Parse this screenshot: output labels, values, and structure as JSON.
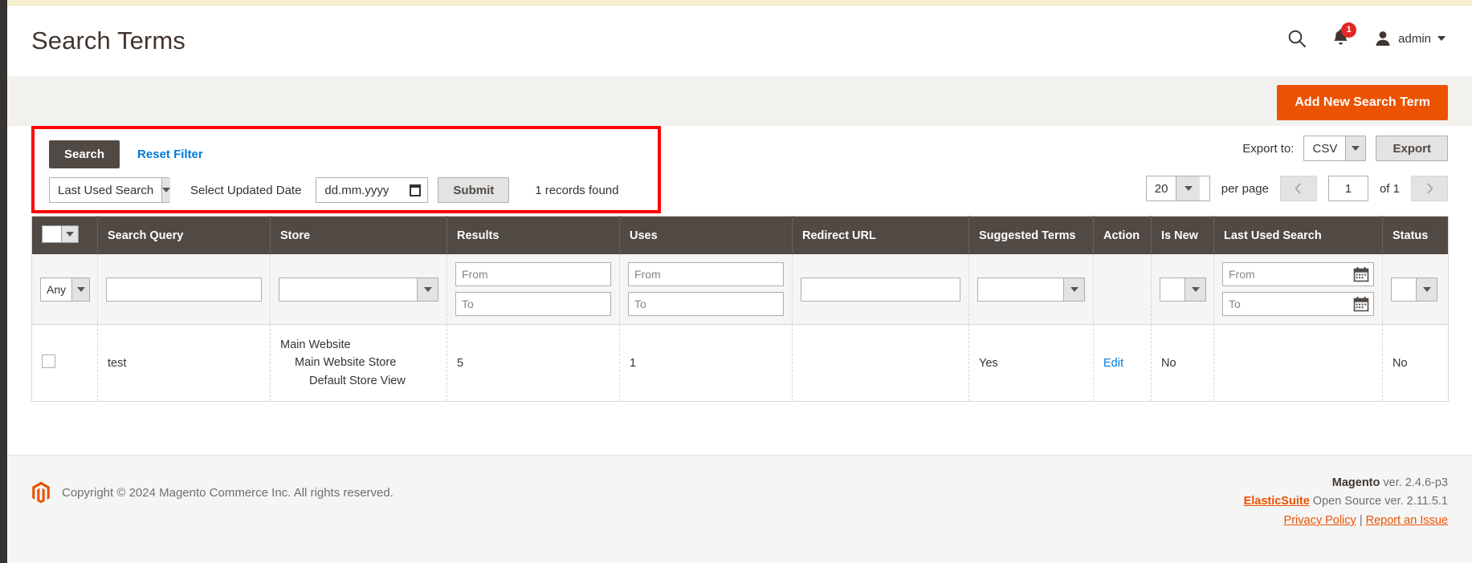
{
  "header": {
    "title": "Search Terms",
    "search_icon": "search-icon",
    "notifications_icon": "bell-icon",
    "notifications_count": "1",
    "user_icon": "user-avatar-icon",
    "user_name": "admin",
    "user_caret": "chevron-down-icon"
  },
  "page_actions": {
    "add_new_label": "Add New Search Term"
  },
  "filters": {
    "search_button": "Search",
    "reset_filter": "Reset Filter",
    "scope_select_value": "Last Used Search",
    "updated_date_label": "Select Updated Date",
    "date_placeholder": "dd.mm.yyyy",
    "date_value": "",
    "submit_button": "Submit",
    "records_found": "1 records found"
  },
  "export": {
    "label": "Export to:",
    "format_value": "CSV",
    "button": "Export"
  },
  "pager": {
    "per_page_value": "20",
    "per_page_label": "per page",
    "prev_icon": "chevron-left-icon",
    "current_page": "1",
    "of_label": "of 1",
    "next_icon": "chevron-right-icon"
  },
  "grid": {
    "columns": [
      {
        "label": ""
      },
      {
        "label": "Search Query"
      },
      {
        "label": "Store"
      },
      {
        "label": "Results"
      },
      {
        "label": "Uses"
      },
      {
        "label": "Redirect URL"
      },
      {
        "label": "Suggested Terms"
      },
      {
        "label": "Action"
      },
      {
        "label": "Is New"
      },
      {
        "label": "Last Used Search"
      },
      {
        "label": "Status"
      }
    ],
    "filter_row": {
      "massaction_value": "Any",
      "search_query_value": "",
      "store_value": "",
      "results_from": "From",
      "results_to": "To",
      "uses_from": "From",
      "uses_to": "To",
      "redirect_url_value": "",
      "suggested_terms_value": "",
      "is_new_value": "",
      "last_used_from": "From",
      "last_used_to": "To",
      "status_value": ""
    },
    "rows": [
      {
        "search_query": "test",
        "store_line1": "Main Website",
        "store_line2": "Main Website Store",
        "store_line3": "Default Store View",
        "results": "5",
        "uses": "1",
        "redirect_url": "",
        "suggested_terms": "Yes",
        "action": "Edit",
        "is_new": "No",
        "last_used_search": "",
        "status": "No"
      }
    ]
  },
  "footer": {
    "copyright": "Copyright © 2024 Magento Commerce Inc. All rights reserved.",
    "magento_label": "Magento",
    "magento_version": " ver. 2.4.6-p3",
    "elasticsuite_label": "ElasticSuite",
    "elasticsuite_version": " Open Source ver. 2.11.5.1",
    "privacy_policy": "Privacy Policy",
    "separator": "|",
    "report_issue": "Report an Issue"
  },
  "colors": {
    "accent_orange": "#eb5202",
    "table_header": "#514943",
    "link_blue": "#007bdb",
    "badge_red": "#e22626",
    "annotation_red": "#ff0000"
  }
}
